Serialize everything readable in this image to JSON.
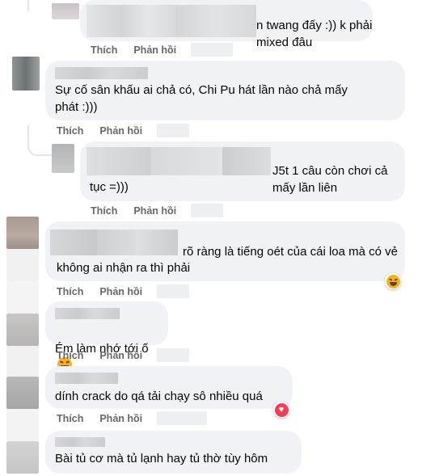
{
  "actions": {
    "like": "Thích",
    "reply": "Phản hồi"
  },
  "comments": [
    {
      "text": "n twang đấy :)) k phải mixed đâu"
    },
    {
      "text": "Sự cố sân khấu ai chả có, Chi Pu hát lần nào chả mấy\nphát :)))"
    },
    {
      "text_line1": "J5t 1 câu còn chơi cả mấy lần liên",
      "text_line2": "tục =)))"
    },
    {
      "text_line1": "rõ ràng là tiếng oét của cái loa mà có vẻ",
      "text_line2": "không ai nhận ra thì phải",
      "reaction": "haha-icon"
    },
    {
      "text": "Ém làm nhớ tới ố",
      "inline_emoji": "haha-icon"
    },
    {
      "text": "dính crack do qá tải chạy sô nhiều quá",
      "reaction": "love-icon"
    },
    {
      "text": "Bài tủ cơ mà tủ lạnh hay tủ thờ tùy hôm"
    }
  ],
  "colors": {
    "bubble": "#f0f2f5",
    "text": "#050505",
    "secondary": "#65676b",
    "haha": "#f7b125",
    "love": "#f33e58"
  }
}
